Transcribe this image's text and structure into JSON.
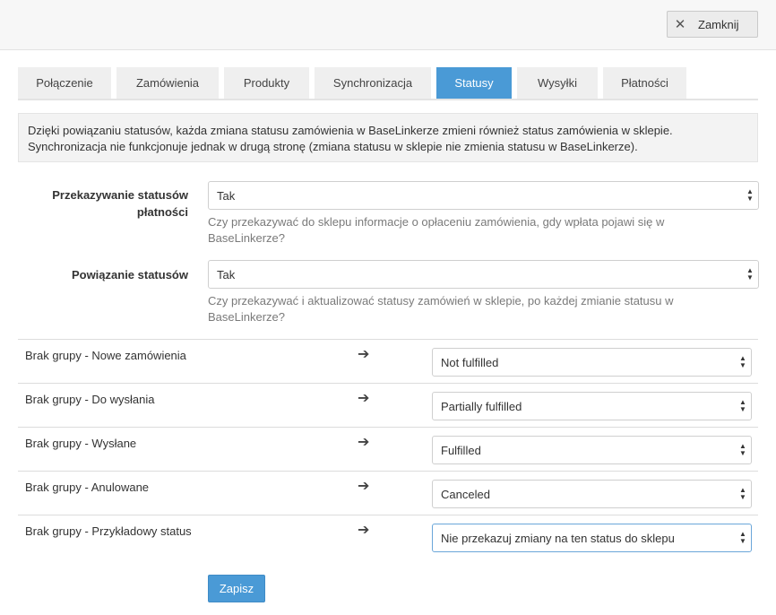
{
  "header": {
    "close_label": "Zamknij",
    "close_icon": "✕"
  },
  "tabs": [
    {
      "label": "Połączenie",
      "active": false
    },
    {
      "label": "Zamówienia",
      "active": false
    },
    {
      "label": "Produkty",
      "active": false
    },
    {
      "label": "Synchronizacja",
      "active": false
    },
    {
      "label": "Statusy",
      "active": true
    },
    {
      "label": "Wysyłki",
      "active": false
    },
    {
      "label": "Płatności",
      "active": false
    }
  ],
  "info": {
    "line1": "Dzięki powiązaniu statusów, każda zmiana statusu zamówienia w BaseLinkerze zmieni również status zamówienia w sklepie.",
    "line2": "Synchronizacja nie funkcjonuje jednak w drugą stronę (zmiana statusu w sklepie nie zmienia statusu w BaseLinkerze)."
  },
  "payment_status": {
    "label_line1": "Przekazywanie statusów",
    "label_line2": "płatności",
    "value": "Tak",
    "help_line1": "Czy przekazywać do sklepu informacje o opłaceniu zamówienia, gdy wpłata pojawi się w",
    "help_line2": "BaseLinkerze?"
  },
  "status_linking": {
    "label": "Powiązanie statusów",
    "value": "Tak",
    "help_line1": "Czy przekazywać i aktualizować statusy zamówień w sklepie, po każdej zmianie statusu w",
    "help_line2": "BaseLinkerze?"
  },
  "mappings": [
    {
      "source": "Brak grupy - Nowe zamówienia",
      "target": "Not fulfilled"
    },
    {
      "source": "Brak grupy - Do wysłania",
      "target": "Partially fulfilled"
    },
    {
      "source": "Brak grupy - Wysłane",
      "target": "Fulfilled"
    },
    {
      "source": "Brak grupy - Anulowane",
      "target": "Canceled"
    },
    {
      "source": "Brak grupy - Przykładowy status",
      "target": "Nie przekazuj zmiany na ten status do sklepu"
    }
  ],
  "arrow_icon": "➔",
  "save_label": "Zapisz",
  "colors": {
    "accent": "#4a9ad6",
    "tab_inactive": "#efefef",
    "info_bg": "#f3f3f3"
  }
}
